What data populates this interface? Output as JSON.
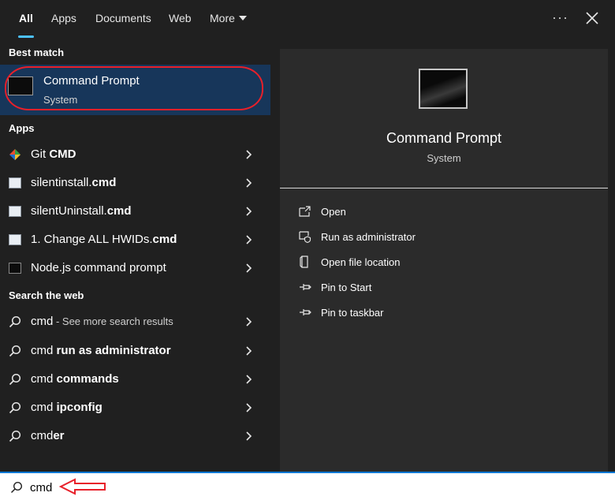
{
  "tabs": [
    {
      "label": "All",
      "active": true
    },
    {
      "label": "Apps",
      "active": false
    },
    {
      "label": "Documents",
      "active": false
    },
    {
      "label": "Web",
      "active": false
    },
    {
      "label": "More",
      "active": false
    }
  ],
  "header": {
    "more_options_icon": "ellipsis-icon",
    "close_icon": "close-icon"
  },
  "best_match": {
    "section_label": "Best match",
    "title": "Command Prompt",
    "subtitle": "System",
    "icon": "cmd-icon"
  },
  "apps": {
    "section_label": "Apps",
    "items": [
      {
        "prefix": "Git ",
        "bold": "CMD",
        "icon": "git-icon"
      },
      {
        "prefix": "silentinstall.",
        "bold": "cmd",
        "icon": "script-icon"
      },
      {
        "prefix": "silentUninstall.",
        "bold": "cmd",
        "icon": "script-icon"
      },
      {
        "prefix": "1. Change ALL HWIDs.",
        "bold": "cmd",
        "icon": "script-icon"
      },
      {
        "prefix": "Node.js command prompt",
        "bold": "",
        "icon": "cmd-icon"
      }
    ]
  },
  "web": {
    "section_label": "Search the web",
    "items": [
      {
        "prefix": "cmd",
        "bold": "",
        "suffix": " - See more search results"
      },
      {
        "prefix": "cmd ",
        "bold": "run as administrator",
        "suffix": ""
      },
      {
        "prefix": "cmd ",
        "bold": "commands",
        "suffix": ""
      },
      {
        "prefix": "cmd ",
        "bold": "ipconfig",
        "suffix": ""
      },
      {
        "prefix": "cmd",
        "bold": "er",
        "suffix": ""
      }
    ]
  },
  "preview": {
    "title": "Command Prompt",
    "subtitle": "System",
    "actions": [
      {
        "label": "Open",
        "icon": "open-icon"
      },
      {
        "label": "Run as administrator",
        "icon": "shield-icon"
      },
      {
        "label": "Open file location",
        "icon": "file-location-icon"
      },
      {
        "label": "Pin to Start",
        "icon": "pin-icon"
      },
      {
        "label": "Pin to taskbar",
        "icon": "pin-icon"
      }
    ]
  },
  "search": {
    "value": "cmd",
    "icon": "search-icon"
  },
  "colors": {
    "accent": "#4cc2ff",
    "selection": "#17365a",
    "annotation": "#e8202a"
  }
}
